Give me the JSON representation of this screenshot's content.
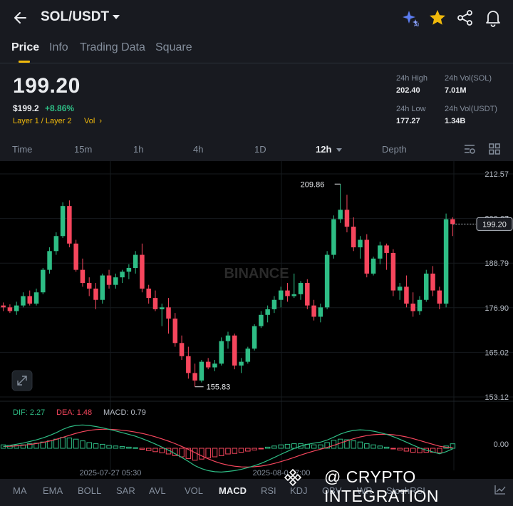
{
  "header": {
    "pair": "SOL/USDT",
    "icons": [
      "back-arrow-icon",
      "ai-sparkle-icon",
      "star-icon",
      "share-icon",
      "bell-icon"
    ],
    "star_color": "#f0b90b"
  },
  "tabs": [
    {
      "label": "Price",
      "active": true
    },
    {
      "label": "Info"
    },
    {
      "label": "Trading Data"
    },
    {
      "label": "Square"
    }
  ],
  "price": {
    "last": "199.20",
    "usd": "$199.2",
    "change": "+8.86%",
    "sector": "Layer 1 / Layer 2",
    "vol_tag": "Vol",
    "stats": {
      "high_label": "24h High",
      "high": "202.40",
      "low_label": "24h Low",
      "low": "177.27",
      "vol_sol_label": "24h Vol(SOL)",
      "vol_sol": "7.01M",
      "vol_usdt_label": "24h Vol(USDT)",
      "vol_usdt": "1.34B"
    }
  },
  "intervals": [
    {
      "label": "Time"
    },
    {
      "label": "15m"
    },
    {
      "label": "1h"
    },
    {
      "label": "4h"
    },
    {
      "label": "1D"
    },
    {
      "label": "12h",
      "active": true
    },
    {
      "label": "Depth"
    }
  ],
  "indicators_bar": [
    "MA",
    "EMA",
    "BOLL",
    "SAR",
    "AVL",
    "VOL",
    "MACD",
    "RSI",
    "KDJ",
    "OBV",
    "WR",
    "StochRSI"
  ],
  "indicators_active": "MACD",
  "macd": {
    "dif": "DIF: 2.27",
    "dea": "DEA: 1.48",
    "macd": "MACD: 0.79",
    "zero_label": "0.00"
  },
  "watermark": "BINANCE",
  "overlay_text": "@ CRYPTO INTEGRATION",
  "colors": {
    "up": "#2ebd85",
    "down": "#f6465d",
    "accent": "#f0b90b",
    "bg": "#181a20",
    "chart_bg": "#000000"
  },
  "chart_data": {
    "type": "candlestick",
    "y_ticks": [
      "212.57",
      "200.67",
      "188.79",
      "176.90",
      "165.02",
      "153.12"
    ],
    "ylim": [
      153.12,
      212.57
    ],
    "x_labels": [
      "2025-07-27 05:30",
      "2025-08-0_ 7:00"
    ],
    "current_price_label": "199.20",
    "annotations": [
      {
        "text": "209.86",
        "value": 209.86
      },
      {
        "text": "155.83",
        "value": 155.83
      }
    ],
    "candles": [
      [
        177.5,
        178.3,
        176.0,
        177.0
      ],
      [
        177.0,
        177.8,
        175.5,
        176.0
      ],
      [
        176.0,
        178.5,
        175.0,
        177.5
      ],
      [
        177.5,
        181.0,
        177.0,
        180.0
      ],
      [
        180.0,
        181.5,
        177.5,
        178.0
      ],
      [
        178.0,
        182.0,
        177.5,
        181.0
      ],
      [
        181.0,
        187.5,
        180.5,
        187.0
      ],
      [
        187.0,
        193.0,
        186.0,
        192.0
      ],
      [
        192.0,
        197.0,
        191.0,
        196.0
      ],
      [
        196.0,
        205.0,
        195.5,
        204.0
      ],
      [
        204.0,
        205.5,
        193.0,
        194.0
      ],
      [
        194.0,
        195.0,
        186.5,
        187.0
      ],
      [
        187.0,
        190.0,
        182.5,
        183.5
      ],
      [
        183.5,
        185.0,
        180.0,
        182.0
      ],
      [
        182.0,
        183.5,
        176.5,
        179.0
      ],
      [
        179.0,
        186.0,
        178.0,
        185.5
      ],
      [
        185.5,
        187.0,
        182.0,
        183.0
      ],
      [
        183.0,
        186.0,
        182.0,
        185.0
      ],
      [
        185.0,
        187.0,
        183.5,
        186.5
      ],
      [
        186.5,
        188.5,
        184.5,
        187.5
      ],
      [
        187.5,
        192.0,
        186.0,
        191.0
      ],
      [
        191.0,
        194.0,
        181.0,
        182.0
      ],
      [
        182.0,
        183.0,
        178.0,
        179.5
      ],
      [
        179.5,
        181.5,
        176.0,
        176.5
      ],
      [
        176.5,
        178.0,
        172.0,
        177.0
      ],
      [
        177.0,
        179.5,
        170.0,
        174.0
      ],
      [
        174.0,
        175.5,
        166.5,
        167.5
      ],
      [
        167.5,
        169.5,
        163.0,
        164.0
      ],
      [
        164.0,
        166.5,
        158.0,
        159.5
      ],
      [
        159.5,
        162.0,
        155.83,
        157.5
      ],
      [
        157.5,
        163.0,
        157.0,
        162.5
      ],
      [
        162.5,
        163.5,
        160.5,
        161.0
      ],
      [
        161.0,
        163.0,
        160.0,
        162.0
      ],
      [
        162.0,
        169.0,
        161.5,
        168.0
      ],
      [
        168.0,
        170.5,
        166.0,
        169.5
      ],
      [
        169.5,
        170.0,
        160.5,
        161.5
      ],
      [
        161.5,
        163.5,
        159.5,
        162.5
      ],
      [
        162.5,
        166.5,
        162.0,
        166.0
      ],
      [
        166.0,
        172.5,
        165.5,
        172.0
      ],
      [
        172.0,
        176.0,
        171.5,
        175.0
      ],
      [
        175.0,
        177.5,
        173.0,
        176.5
      ],
      [
        176.5,
        180.0,
        175.5,
        179.0
      ],
      [
        179.0,
        182.5,
        177.0,
        181.5
      ],
      [
        181.5,
        183.5,
        178.5,
        180.0
      ],
      [
        180.0,
        186.0,
        179.5,
        180.5
      ],
      [
        180.5,
        184.0,
        179.0,
        183.5
      ],
      [
        183.5,
        184.5,
        176.5,
        177.5
      ],
      [
        177.5,
        179.0,
        173.5,
        174.5
      ],
      [
        174.5,
        178.0,
        173.0,
        177.0
      ],
      [
        177.0,
        192.0,
        176.5,
        191.0
      ],
      [
        191.0,
        201.5,
        190.0,
        200.5
      ],
      [
        200.5,
        209.86,
        199.5,
        203.0
      ],
      [
        203.0,
        207.0,
        197.0,
        198.5
      ],
      [
        198.5,
        201.0,
        192.0,
        193.0
      ],
      [
        193.0,
        196.0,
        190.0,
        195.0
      ],
      [
        195.0,
        196.5,
        185.0,
        186.0
      ],
      [
        186.0,
        190.5,
        185.5,
        190.0
      ],
      [
        190.0,
        194.5,
        188.5,
        193.5
      ],
      [
        193.5,
        194.0,
        187.0,
        191.5
      ],
      [
        191.5,
        192.5,
        180.0,
        181.5
      ],
      [
        181.5,
        183.5,
        179.0,
        182.5
      ],
      [
        182.5,
        185.5,
        177.0,
        178.0
      ],
      [
        178.0,
        181.0,
        174.5,
        176.0
      ],
      [
        176.0,
        180.0,
        175.0,
        179.0
      ],
      [
        179.0,
        187.0,
        178.5,
        186.0
      ],
      [
        186.0,
        188.0,
        180.0,
        181.5
      ],
      [
        181.5,
        182.5,
        176.5,
        178.0
      ],
      [
        178.0,
        202.0,
        177.0,
        200.5
      ],
      [
        200.5,
        201.0,
        196.0,
        199.2
      ]
    ],
    "macd_hist": [
      0.6,
      0.5,
      0.5,
      0.6,
      0.8,
      0.9,
      1.1,
      1.3,
      1.6,
      1.9,
      1.8,
      1.6,
      1.3,
      1.0,
      0.8,
      0.7,
      0.5,
      0.4,
      0.3,
      0.2,
      0.1,
      -0.2,
      -0.4,
      -0.6,
      -0.8,
      -1.0,
      -1.3,
      -1.5,
      -1.8,
      -2.1,
      -1.9,
      -1.7,
      -1.5,
      -1.3,
      -1.0,
      -0.9,
      -0.7,
      -0.5,
      -0.3,
      -0.1,
      0.2,
      0.4,
      0.6,
      0.7,
      0.8,
      0.8,
      0.7,
      0.6,
      0.6,
      1.0,
      1.4,
      1.6,
      1.5,
      1.3,
      1.1,
      0.8,
      0.6,
      0.4,
      0.2,
      -0.1,
      -0.3,
      -0.5,
      -0.7,
      -0.8,
      -0.7,
      -0.7,
      -0.8,
      0.4,
      0.79
    ]
  }
}
